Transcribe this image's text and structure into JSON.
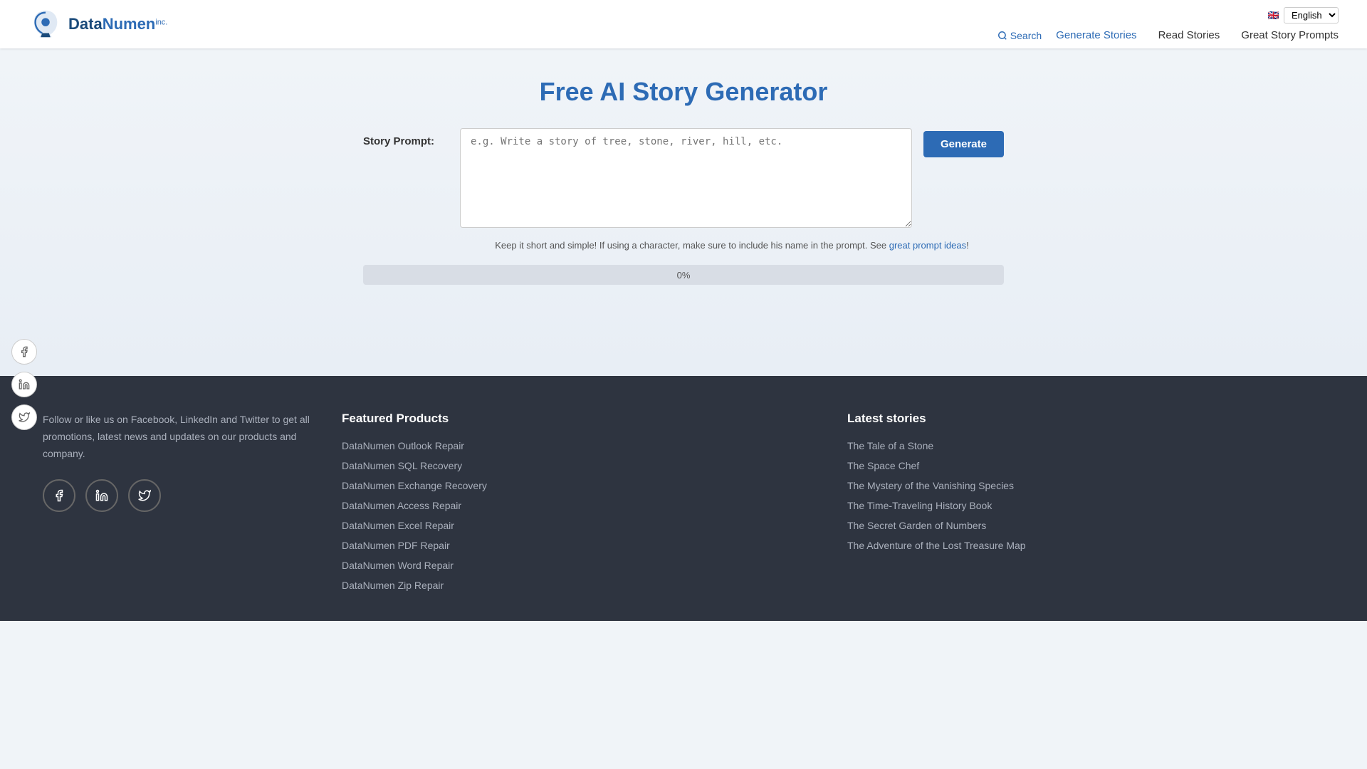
{
  "header": {
    "logo_text_data": "Data",
    "logo_text_numen": "Numen",
    "logo_inc": "inc.",
    "search_label": "Search",
    "language": "English",
    "nav": {
      "generate": "Generate Stories",
      "read": "Read Stories",
      "prompts": "Great Story Prompts"
    }
  },
  "main": {
    "title": "Free AI Story Generator",
    "form_label": "Story Prompt:",
    "textarea_placeholder": "e.g. Write a story of tree, stone, river, hill, etc.",
    "generate_button": "Generate",
    "hint_text": "Keep it short and simple! If using a character, make sure to include his name in the prompt. See ",
    "hint_link_text": "great prompt ideas",
    "hint_suffix": "!",
    "progress_label": "0%"
  },
  "social_sidebar": {
    "facebook": "f",
    "linkedin": "in",
    "twitter": "t"
  },
  "footer": {
    "description": "Follow or like us on Facebook, LinkedIn and Twitter to get all promotions, latest news and updates on our products and company.",
    "featured_products_title": "Featured Products",
    "latest_stories_title": "Latest stories",
    "products": [
      "DataNumen Outlook Repair",
      "DataNumen SQL Recovery",
      "DataNumen Exchange Recovery",
      "DataNumen Access Repair",
      "DataNumen Excel Repair",
      "DataNumen PDF Repair",
      "DataNumen Word Repair",
      "DataNumen Zip Repair"
    ],
    "stories": [
      "The Tale of a Stone",
      "The Space Chef",
      "The Mystery of the Vanishing Species",
      "The Time-Traveling History Book",
      "The Secret Garden of Numbers",
      "The Adventure of the Lost Treasure Map"
    ]
  }
}
